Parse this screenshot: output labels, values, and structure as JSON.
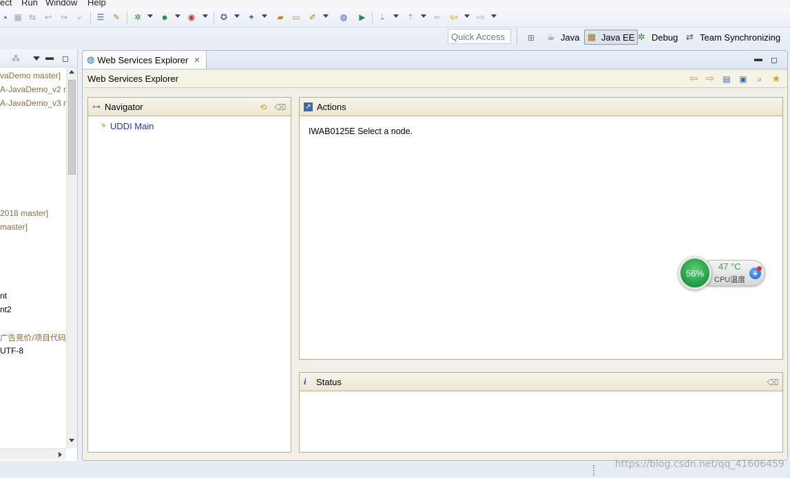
{
  "menu": {
    "items": [
      "ect",
      "Run",
      "Window",
      "Help"
    ]
  },
  "perspectives": {
    "quick_access_placeholder": "Quick Access",
    "items": [
      {
        "label": "Java",
        "icon": "java-perspective-icon"
      },
      {
        "label": "Java EE",
        "icon": "javaee-perspective-icon",
        "active": true
      },
      {
        "label": "Debug",
        "icon": "debug-perspective-icon"
      },
      {
        "label": "Team Synchronizing",
        "icon": "team-sync-icon"
      }
    ]
  },
  "left_panel": {
    "items": [
      {
        "text": "vaDemo master]",
        "style": "git"
      },
      {
        "text": "A-JavaDemo_v2 n",
        "style": "git"
      },
      {
        "text": "A-JavaDemo_v3 n",
        "style": "git"
      },
      {
        "text": "2018 master]",
        "style": "git"
      },
      {
        "text": "master]",
        "style": "git"
      },
      {
        "text": "nt",
        "style": "plain"
      },
      {
        "text": "nt2",
        "style": "plain"
      },
      {
        "text": "广告竞价/项目代码",
        "style": "git"
      },
      {
        "text": "UTF-8",
        "style": "plain"
      }
    ]
  },
  "editor": {
    "tab_label": "Web Services Explorer",
    "title": "Web Services Explorer",
    "navigator": {
      "title": "Navigator",
      "tree_root": "UDDI Main"
    },
    "actions": {
      "title": "Actions",
      "message": "IWAB0125E Select a node."
    },
    "status": {
      "title": "Status"
    }
  },
  "cpu_widget": {
    "percent": "56%",
    "temperature": "47 °C",
    "label": "CPU温度"
  },
  "watermark": "https://blog.csdn.net/qq_41606459",
  "colors": {
    "tree_link": "#1a33cc",
    "git_decoration": "#8b6a3a",
    "cpu_green": "#1e9a40"
  }
}
